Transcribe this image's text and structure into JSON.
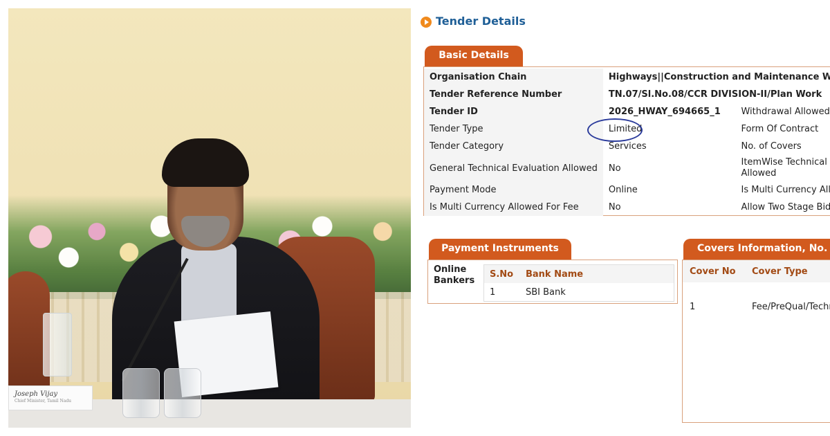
{
  "photo": {
    "nameplate": "Joseph Vijay",
    "nameplate_sub": "Chief Minister, Tamil Nadu"
  },
  "tender": {
    "title": "Tender Details",
    "basic_details": {
      "tab_label": "Basic Details",
      "rows": [
        {
          "label": "Organisation Chain",
          "value": "Highways||Construction and Maintenance Wing||",
          "extra": ""
        },
        {
          "label": "Tender Reference Number",
          "value": "TN.07/Sl.No.08/CCR DIVISION-II/Plan Work",
          "extra": ""
        },
        {
          "label": "Tender ID",
          "value": "2026_HWAY_694665_1",
          "extra": "Withdrawal Allowed"
        },
        {
          "label": "Tender Type",
          "value": "Limited",
          "extra": "Form Of Contract"
        },
        {
          "label": "Tender Category",
          "value": "Services",
          "extra": "No. of Covers"
        },
        {
          "label": "General Technical Evaluation Allowed",
          "value": "No",
          "extra": "ItemWise Technical Allowed"
        },
        {
          "label": "Payment Mode",
          "value": "Online",
          "extra": "Is Multi Currency Allowed"
        },
        {
          "label": "Is Multi Currency Allowed For Fee",
          "value": "No",
          "extra": "Allow Two Stage Bidding"
        }
      ]
    },
    "payment_instruments": {
      "tab_label": "Payment Instruments",
      "label": "Online Bankers",
      "headers": {
        "sno": "S.No",
        "bank": "Bank Name"
      },
      "rows": [
        {
          "sno": "1",
          "bank": "SBI Bank"
        }
      ]
    },
    "covers": {
      "tab_label": "Covers Information, No. of Covers",
      "headers": {
        "no": "Cover No",
        "type": "Cover Type"
      },
      "rows": [
        {
          "no": "1",
          "type": "Fee/PreQual/Technical"
        }
      ]
    },
    "colors": {
      "tab": "#d25a1e",
      "title": "#1f5f97",
      "highlight_circle": "#2c3c9c"
    }
  }
}
